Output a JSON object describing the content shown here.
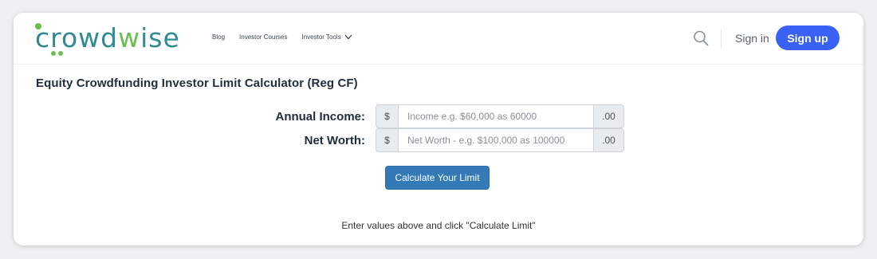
{
  "colors": {
    "brand_teal": "#2f8a93",
    "brand_green": "#6cbf4f",
    "signup_blue": "#3a61f5",
    "calculate_blue": "#337ab7"
  },
  "logo": {
    "part1": "crowd",
    "part2": "w",
    "part3": "ise"
  },
  "nav": {
    "items": [
      {
        "label": "Blog"
      },
      {
        "label": "Investor Courses"
      },
      {
        "label": "Investor Tools",
        "icon": "chevron-down-icon"
      }
    ],
    "search_icon": "search-icon",
    "signin_label": "Sign in",
    "signup_label": "Sign up"
  },
  "calculator": {
    "title": "Equity Crowdfunding Investor Limit Calculator (Reg CF)",
    "fields": [
      {
        "label": "Annual Income:",
        "prefix": "$",
        "placeholder": "Income e.g. $60,000 as 60000",
        "value": "",
        "suffix": ".00"
      },
      {
        "label": "Net Worth:",
        "prefix": "$",
        "placeholder": "Net Worth - e.g. $100,000 as 100000",
        "value": "",
        "suffix": ".00"
      }
    ],
    "button_label": "Calculate Your Limit",
    "result_text": "Enter values above and click \"Calculate Limit\""
  }
}
